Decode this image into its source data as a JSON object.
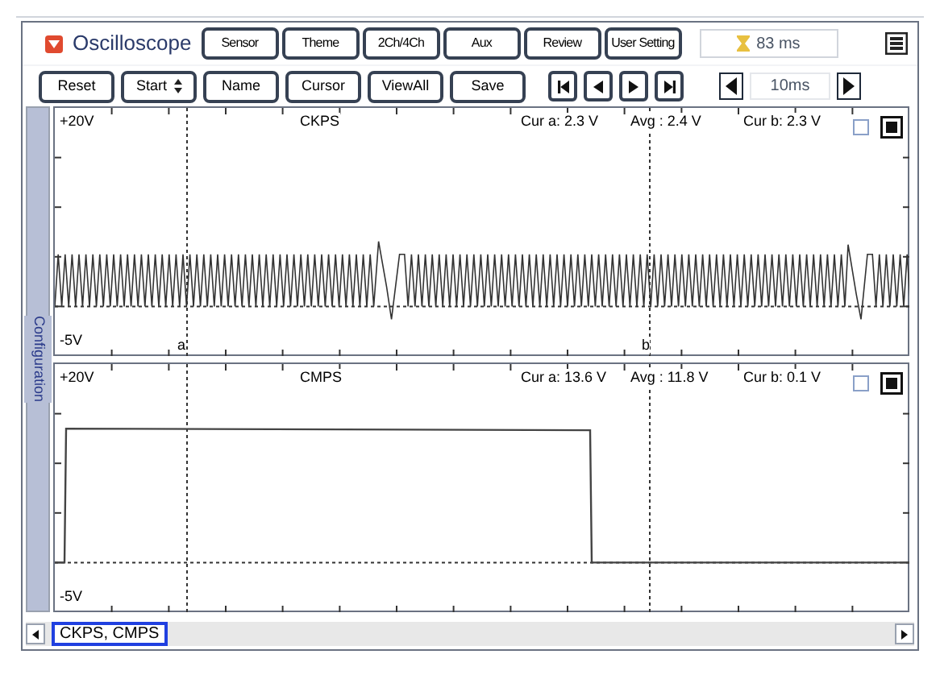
{
  "app": {
    "title": "Oscilloscope"
  },
  "top_buttons": [
    "Sensor",
    "Theme",
    "2Ch/4Ch",
    "Aux",
    "Review",
    "User Setting"
  ],
  "sample_time": "83 ms",
  "toolbar_buttons": [
    {
      "label": "Reset",
      "kind": "plain"
    },
    {
      "label": "Start",
      "kind": "spinner"
    },
    {
      "label": "Name",
      "kind": "plain"
    },
    {
      "label": "Cursor",
      "kind": "plain"
    },
    {
      "label": "ViewAll",
      "kind": "plain"
    },
    {
      "label": "Save",
      "kind": "plain"
    }
  ],
  "time_base": "10ms",
  "sidebar": {
    "label": "Configuration"
  },
  "channels": [
    {
      "name": "CKPS",
      "max": "+20V",
      "min": "-5V",
      "cur_a": "Cur a: 2.3 V",
      "avg": "Avg : 2.4 V",
      "cur_b": "Cur b: 2.3 V",
      "kind": "oscillation",
      "cursor_labels": [
        "a",
        "b"
      ]
    },
    {
      "name": "CMPS",
      "max": "+20V",
      "min": "-5V",
      "cur_a": "Cur a: 13.6 V",
      "avg": "Avg : 11.8 V",
      "cur_b": "Cur b: 0.1 V",
      "kind": "square"
    }
  ],
  "scroll_tag": "CKPS, CMPS"
}
